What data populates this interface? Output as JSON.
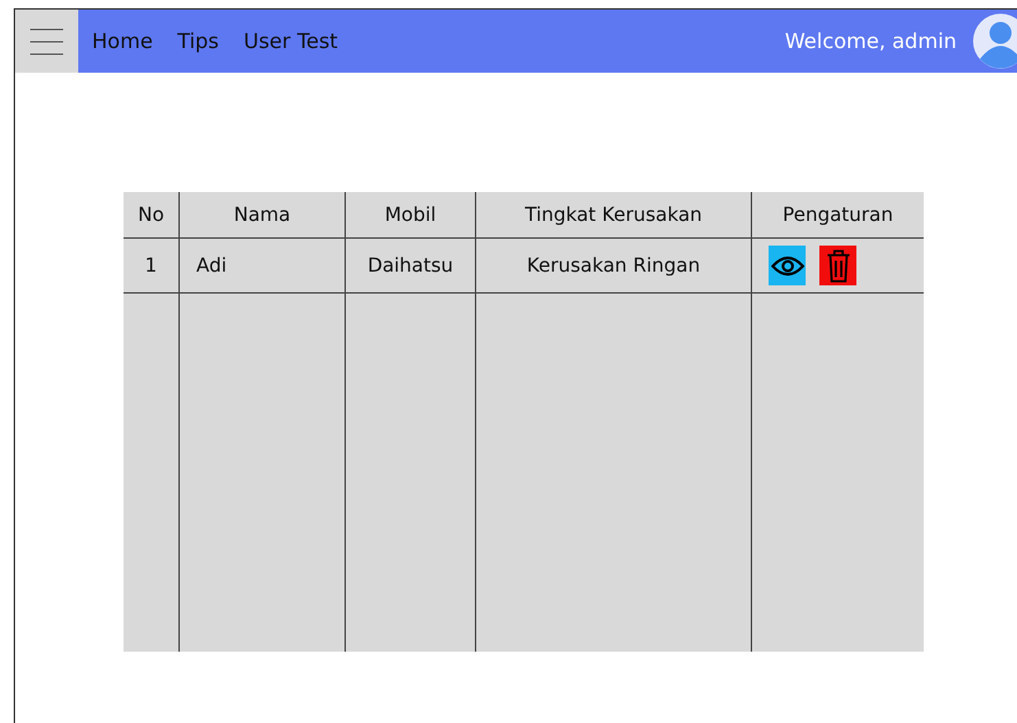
{
  "nav": {
    "links": [
      "Home",
      "Tips",
      "User Test"
    ],
    "welcome": "Welcome, admin"
  },
  "table": {
    "columns": [
      "No",
      "Nama",
      "Mobil",
      "Tingkat Kerusakan",
      "Pengaturan"
    ],
    "rows": [
      {
        "no": "1",
        "nama": "Adi",
        "mobil": "Daihatsu",
        "tingkat": "Kerusakan Ringan"
      }
    ]
  }
}
